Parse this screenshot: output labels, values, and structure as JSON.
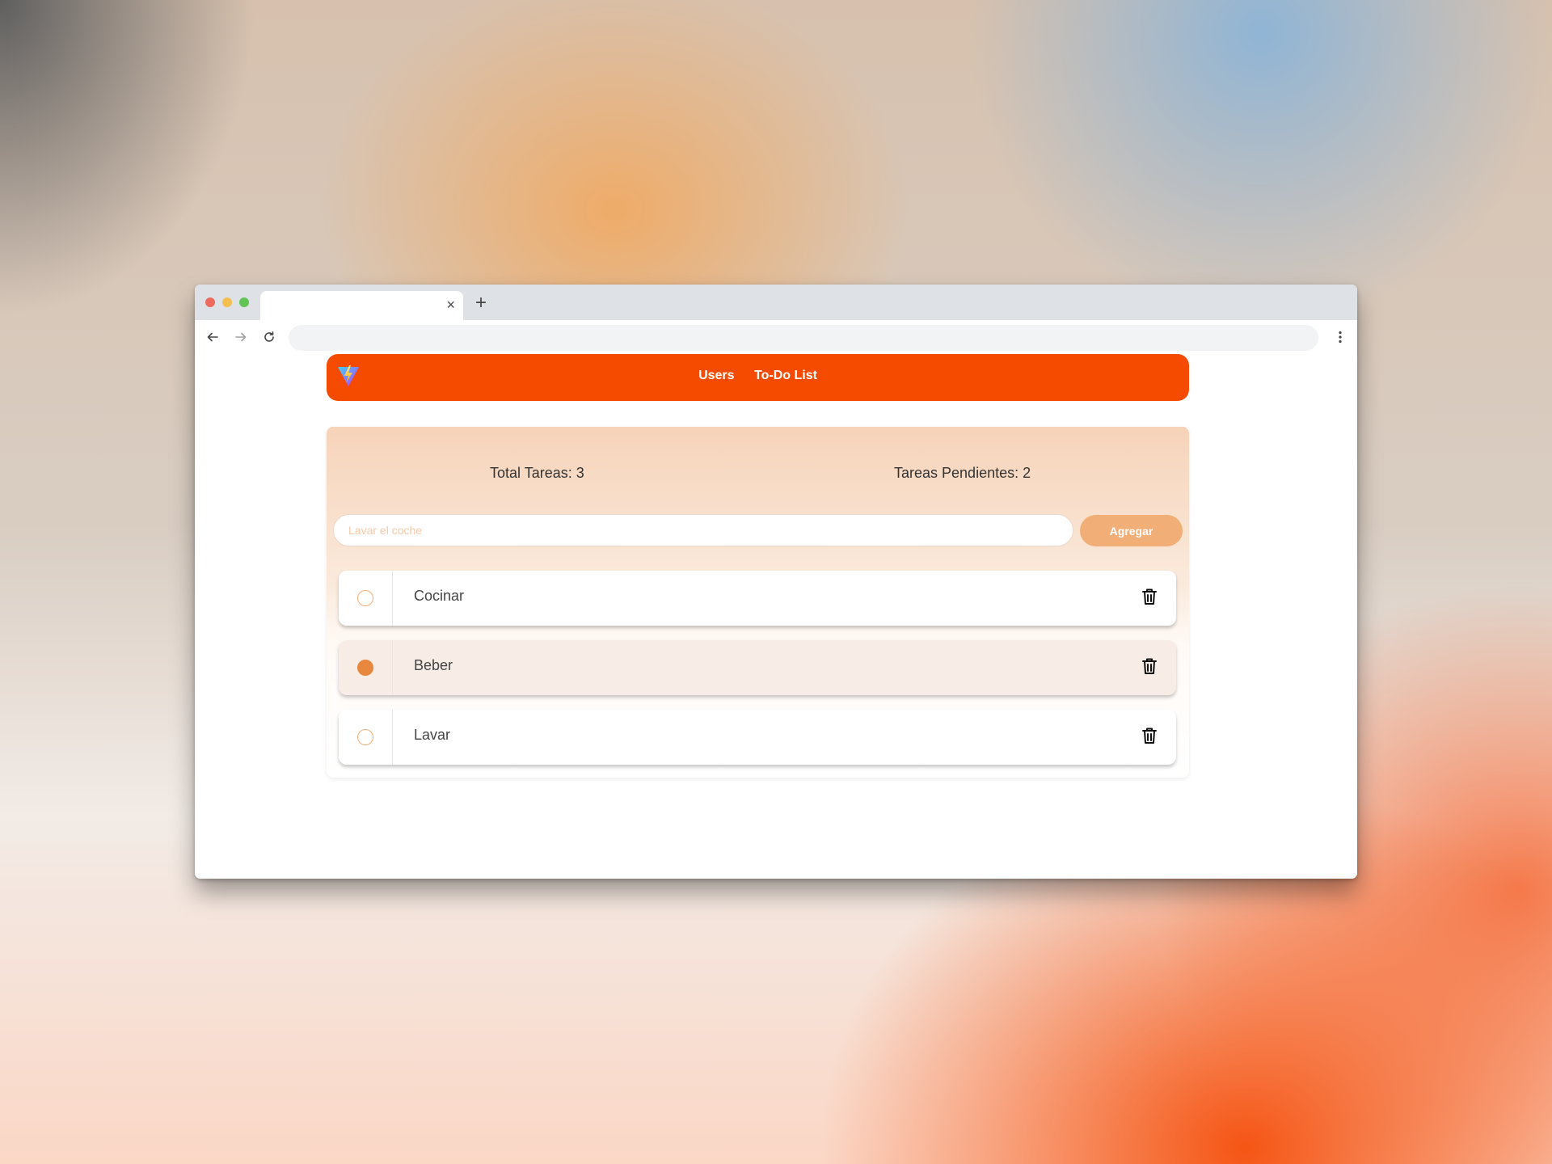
{
  "browser": {
    "tab": {
      "title": "",
      "close_glyph": "×"
    },
    "new_tab_glyph": "+",
    "address": ""
  },
  "nav": {
    "logo_icon": "vite-logo-icon",
    "links": [
      {
        "label": "Users"
      },
      {
        "label": "To-Do List"
      }
    ],
    "color": "#f54b00"
  },
  "stats": {
    "total": "Total Tareas: 3",
    "pending": "Tareas Pendientes: 2"
  },
  "form": {
    "placeholder": "Lavar el coche",
    "value": "",
    "add_label": "Agregar"
  },
  "tasks": [
    {
      "label": "Cocinar",
      "done": false
    },
    {
      "label": "Beber",
      "done": true
    },
    {
      "label": "Lavar",
      "done": false
    }
  ],
  "colors": {
    "accent": "#f1ae76",
    "checked": "#e8883e"
  }
}
